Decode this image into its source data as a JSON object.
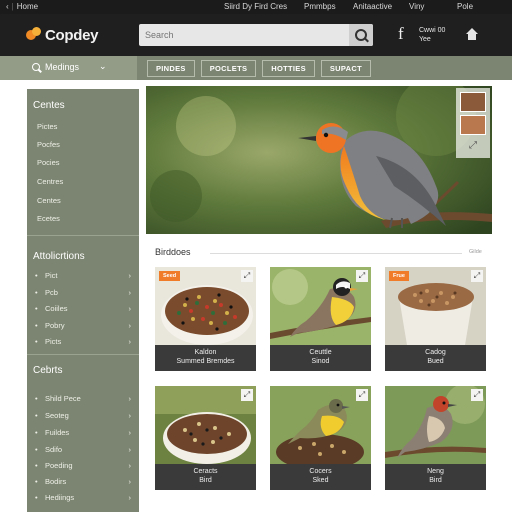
{
  "colors": {
    "topbar": "#1b1b1b",
    "brandbar": "#1f1f1f",
    "nav": "#7c8571",
    "sidebar": "#7c8571",
    "accent": "#f07c2a",
    "caption": "#3a3a3a"
  },
  "topbar": {
    "back_glyph": "‹",
    "home_text": "Home",
    "links": [
      "Siird Dy Fird Cres",
      "Pmmbps",
      "Anitaactive",
      "Viny",
      "Pole"
    ]
  },
  "brand": {
    "name": "Copdey",
    "logo_icon": "bird-logo-icon"
  },
  "search": {
    "placeholder": "Search"
  },
  "account": {
    "icon": "facebook-icon",
    "line1": "Cwwi 00",
    "line2": "Yee"
  },
  "nav": {
    "menu_label": "Medings",
    "menu_icon": "search-icon",
    "tabs": [
      "PINDES",
      "POCLETS",
      "HOTTIES",
      "SUPACT"
    ]
  },
  "sidebar": {
    "sections": [
      {
        "title": "Centes",
        "links": [
          "Pictes",
          "Pocfes",
          "Pocies",
          "Centres",
          "Centes",
          "Ecetes"
        ]
      },
      {
        "title": "Attolicrtions",
        "items": [
          "Pict",
          "Pcb",
          "Coiiles",
          "Pobry",
          "Picts"
        ]
      },
      {
        "title": "Cebrts",
        "items": [
          "Shild Pece",
          "Seoteg",
          "Fuildes",
          "Sdifo",
          "Poeding",
          "Bodirs",
          "Hediings"
        ]
      }
    ]
  },
  "hero": {
    "thumb_icons": [
      "seed-thumb",
      "food-thumb"
    ],
    "expand_icon": "expand-icon"
  },
  "products": {
    "section_title": "Birddoes",
    "more_label": "Gilde",
    "cards": [
      {
        "badge": "Seed",
        "line1": "Kaldon",
        "line2": "Summed Bremdes",
        "corner_icon": "expand-icon",
        "kind": "seedbowl"
      },
      {
        "badge": "",
        "line1": "Ceuttle",
        "line2": "Sinod",
        "corner_icon": "expand-icon",
        "kind": "bird-a"
      },
      {
        "badge": "Frue",
        "line1": "Cadog",
        "line2": "Bued",
        "corner_icon": "expand-icon",
        "kind": "seedcup"
      },
      {
        "badge": "",
        "line1": "Ceracts",
        "line2": "Bird",
        "corner_icon": "expand-icon",
        "kind": "seedbowl2"
      },
      {
        "badge": "",
        "line1": "Cocers",
        "line2": "Sked",
        "corner_icon": "expand-icon",
        "kind": "bird-b"
      },
      {
        "badge": "",
        "line1": "Neng",
        "line2": "Bird",
        "corner_icon": "expand-icon",
        "kind": "bird-c"
      }
    ]
  }
}
